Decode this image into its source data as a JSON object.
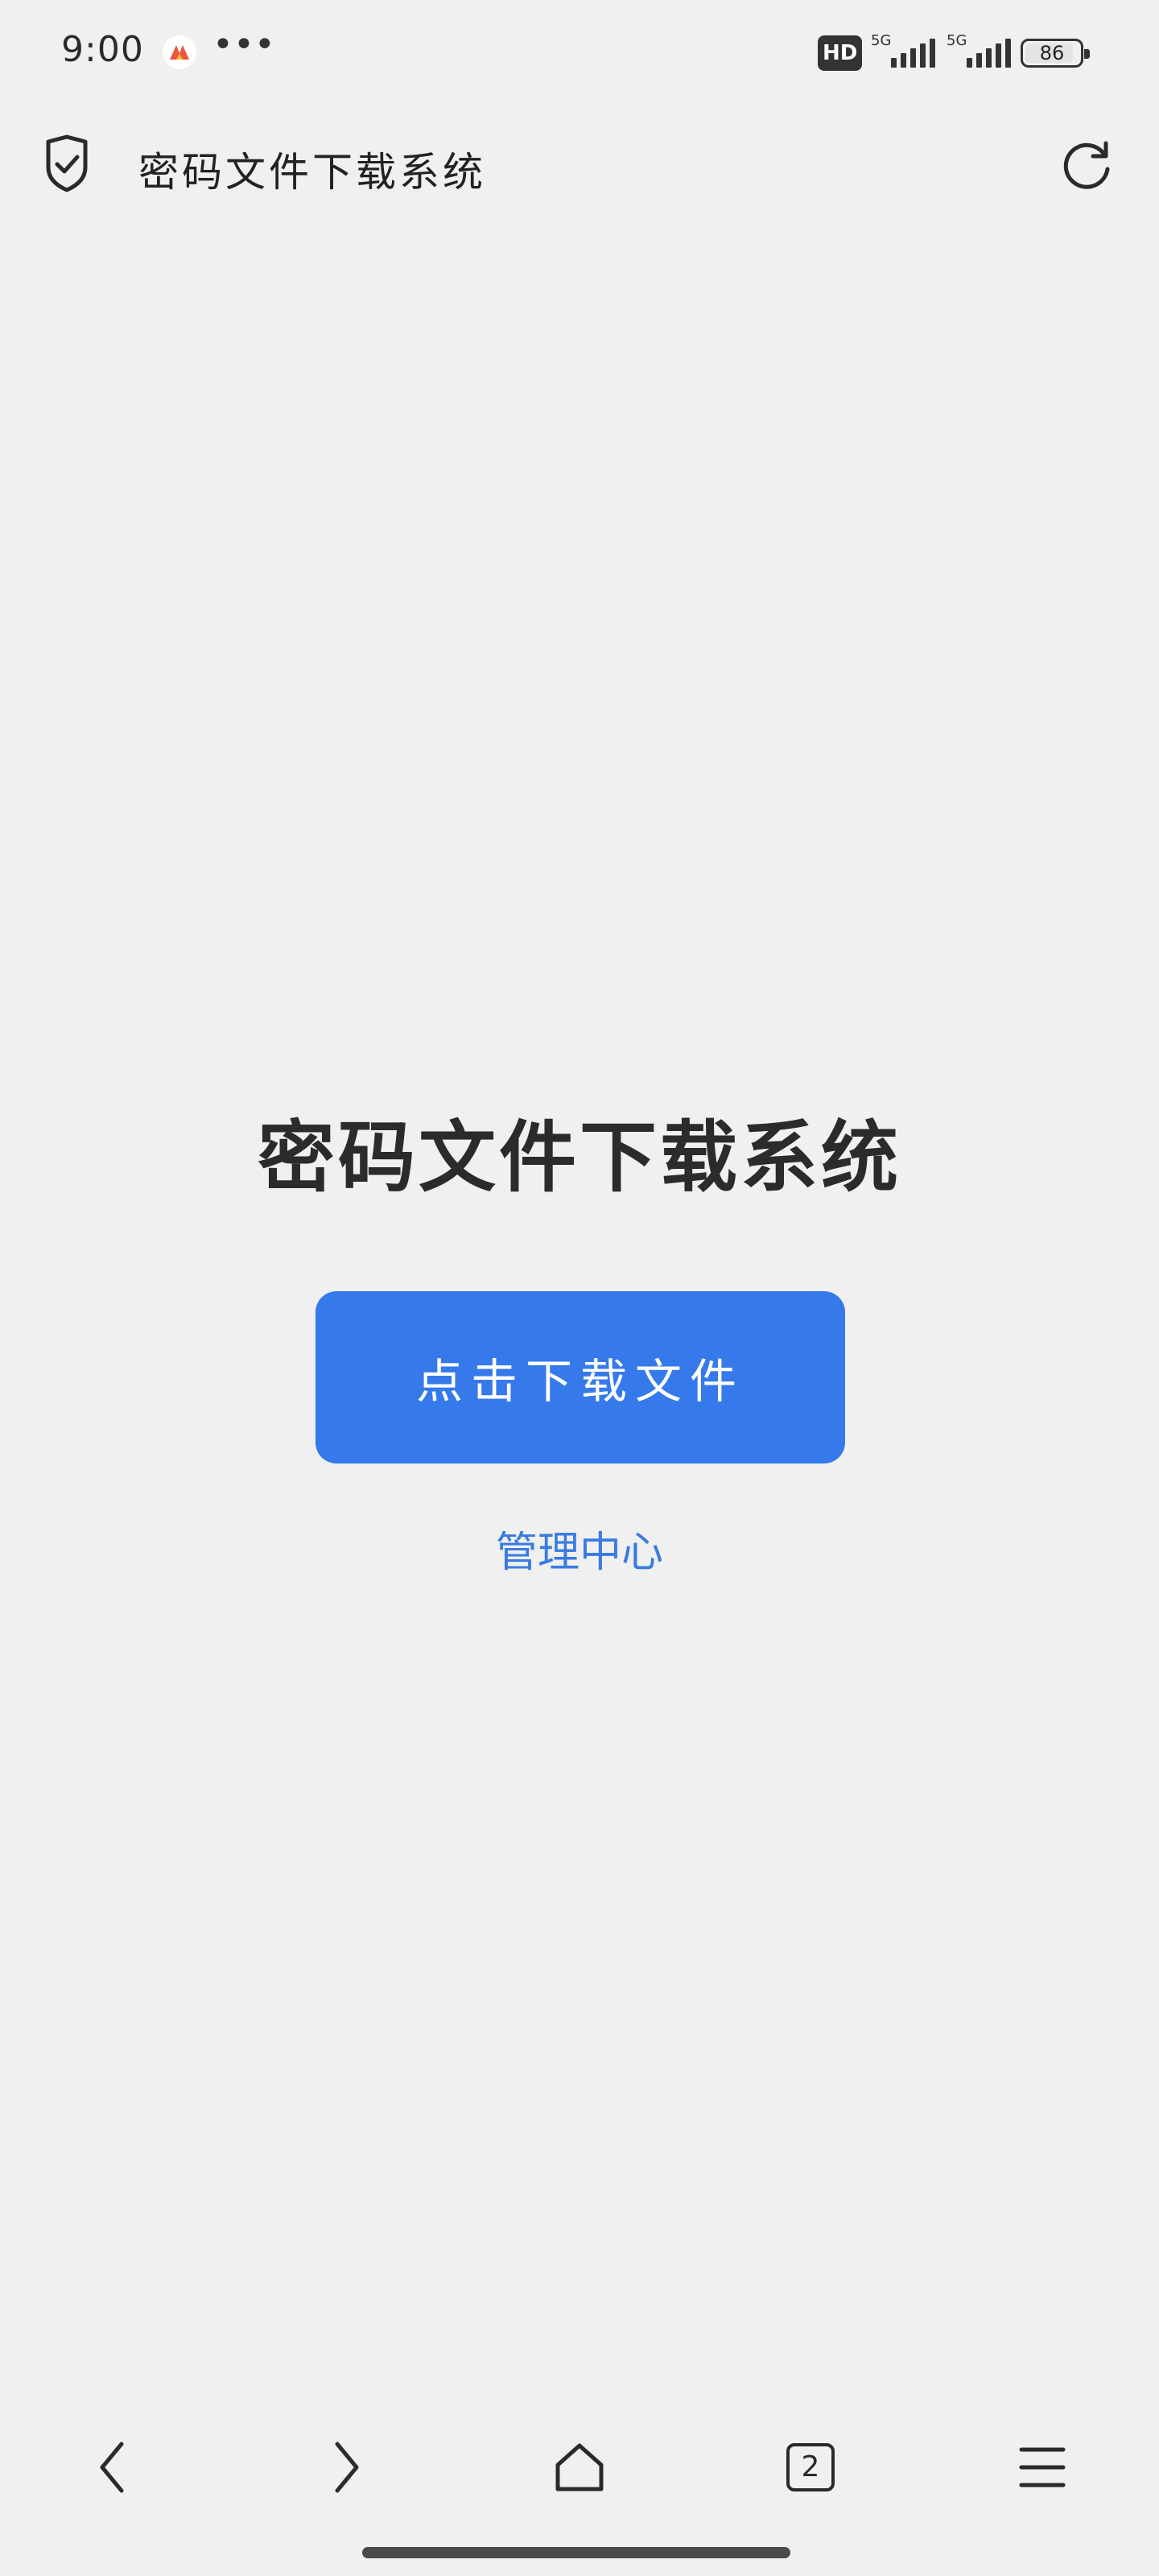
{
  "status_bar": {
    "time": "9:00",
    "more": "•••",
    "hd_label": "HD",
    "network_1": "5G",
    "network_2": "5G",
    "battery": "86"
  },
  "browser": {
    "page_title": "密码文件下载系统"
  },
  "main": {
    "heading": "密码文件下载系统",
    "download_button": "点击下载文件",
    "admin_link": "管理中心"
  },
  "bottom_nav": {
    "tab_count": "2"
  },
  "colors": {
    "accent": "#3679ea",
    "link": "#3a7be0",
    "background": "#f0f0f0"
  },
  "icons": {
    "header_left": "shield-check-icon",
    "header_right": "reload-icon",
    "nav": [
      "back-icon",
      "forward-icon",
      "home-icon",
      "tabs-icon",
      "menu-icon"
    ]
  }
}
